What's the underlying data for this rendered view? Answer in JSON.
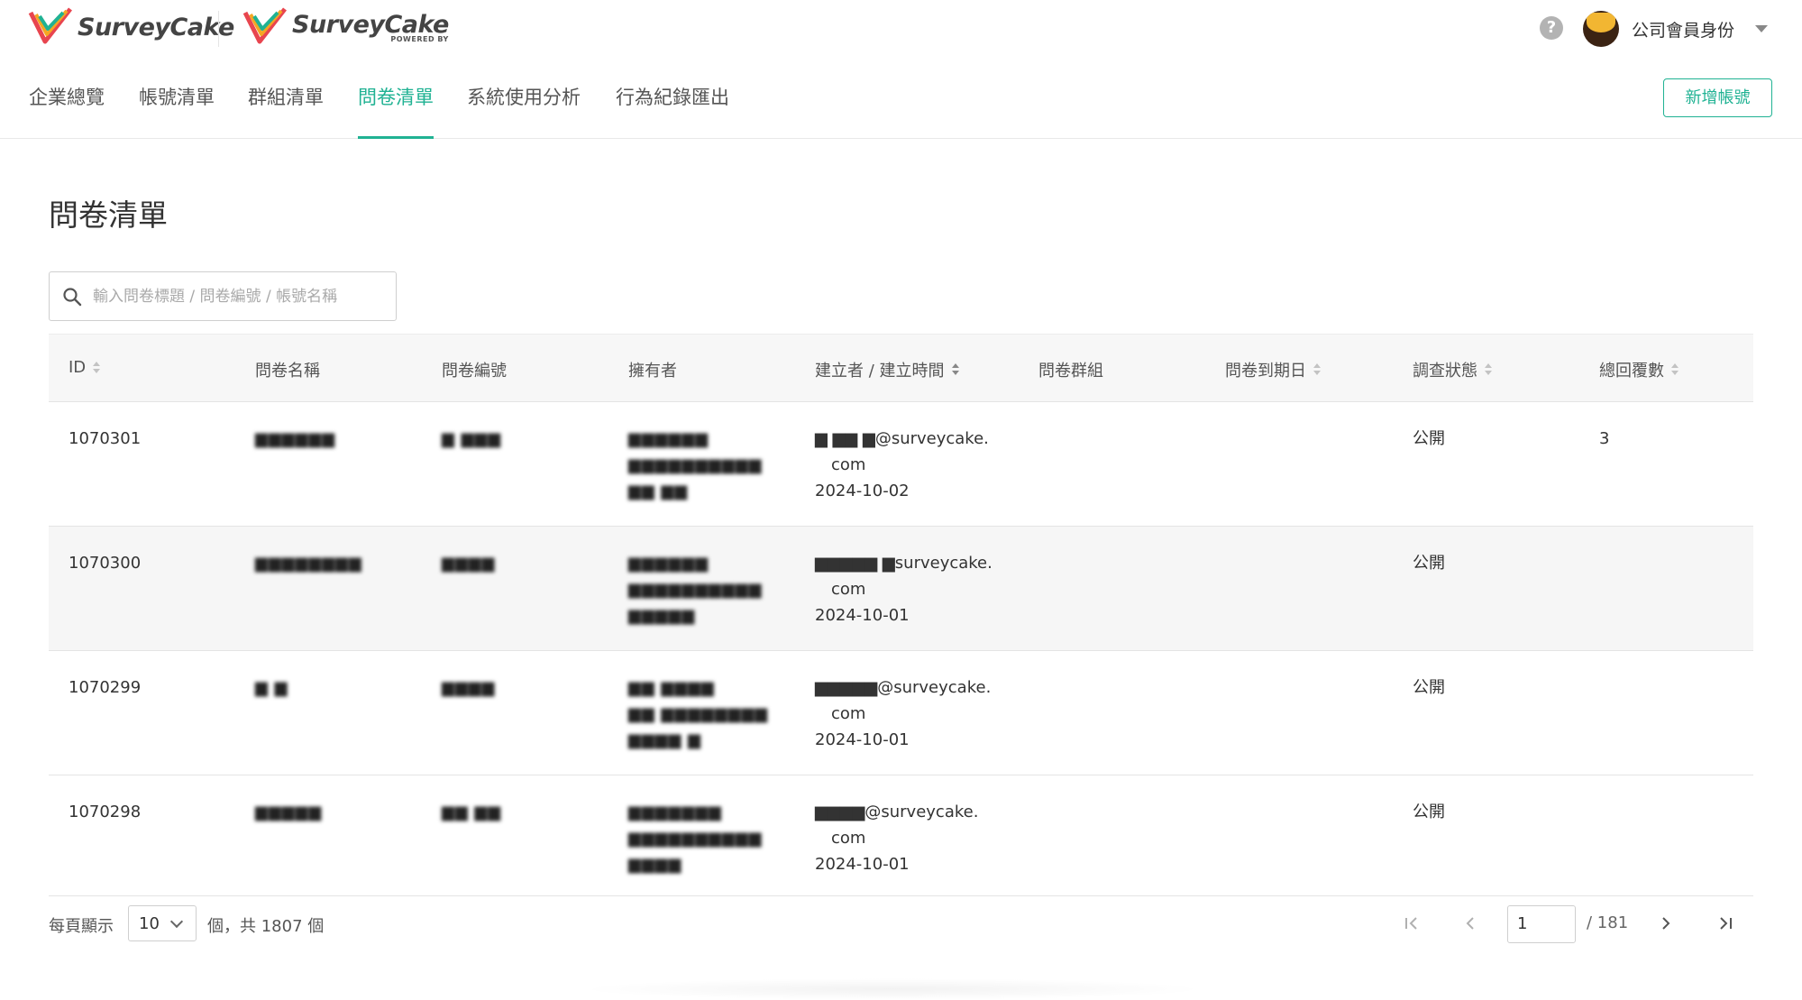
{
  "brand": {
    "logo_text": "SurveyCake",
    "logo2_text": "SurveyCake",
    "powered_by": "POWERED BY",
    "accent_color": "#20b293"
  },
  "header": {
    "help_icon": "question-circle-icon",
    "user_label": "公司會員身份"
  },
  "nav": {
    "tabs": [
      {
        "label": "企業總覽",
        "active": false
      },
      {
        "label": "帳號清單",
        "active": false
      },
      {
        "label": "群組清單",
        "active": false
      },
      {
        "label": "問卷清單",
        "active": true
      },
      {
        "label": "系統使用分析",
        "active": false
      },
      {
        "label": "行為紀錄匯出",
        "active": false
      }
    ],
    "add_account_label": "新增帳號"
  },
  "page": {
    "title": "問卷清單"
  },
  "search": {
    "placeholder": "輸入問卷標題 / 問卷編號 / 帳號名稱",
    "value": ""
  },
  "table": {
    "columns": [
      "ID",
      "問卷名稱",
      "問卷編號",
      "擁有者",
      "建立者 / 建立時間",
      "問卷群組",
      "問卷到期日",
      "調查狀態",
      "總回覆數"
    ],
    "rows": [
      {
        "id": "1070301",
        "name": "▆▆▆▆▆▆",
        "code": "▆ ▆▆▆",
        "owner": [
          "▆▆▆▆▆▆",
          "▆▆▆▆▆▆▆▆▆▆",
          "▆▆ ▆▆"
        ],
        "creator_email_1": "▆ ▆▆ ▆@surveycake.",
        "creator_email_2": "com",
        "created": "2024-10-02",
        "group": "",
        "expiry": "",
        "status": "公開",
        "replies": "3"
      },
      {
        "id": "1070300",
        "name": "▆▆▆▆▆▆▆▆",
        "code": "▆▆▆▆",
        "owner": [
          "▆▆▆▆▆▆",
          "▆▆▆▆▆▆▆▆▆▆",
          "▆▆▆▆▆"
        ],
        "creator_email_1": "▆▆▆▆▆ ▆surveycake.",
        "creator_email_2": "com",
        "created": "2024-10-01",
        "group": "",
        "expiry": "",
        "status": "公開",
        "replies": ""
      },
      {
        "id": "1070299",
        "name": "▆ ▆",
        "code": "▆▆▆▆",
        "owner": [
          "▆▆ ▆▆▆▆",
          "▆▆ ▆▆▆▆▆▆▆▆",
          "▆▆▆▆ ▆"
        ],
        "creator_email_1": "▆▆▆▆▆@surveycake.",
        "creator_email_2": "com",
        "created": "2024-10-01",
        "group": "",
        "expiry": "",
        "status": "公開",
        "replies": ""
      },
      {
        "id": "1070298",
        "name": "▆▆▆▆▆",
        "code": "▆▆ ▆▆",
        "owner": [
          "▆▆▆▆▆▆▆",
          "▆▆▆▆▆▆▆▆▆▆",
          "▆▆▆▆"
        ],
        "creator_email_1": "▆▆▆▆@surveycake.",
        "creator_email_2": "com",
        "created": "2024-10-01",
        "group": "",
        "expiry": "",
        "status": "公開",
        "replies": ""
      }
    ]
  },
  "pagination": {
    "per_page_label": "每頁顯示",
    "page_size": "10",
    "total_label": "個，共 1807 個",
    "current_page": "1",
    "total_pages": "/ 181",
    "first_icon": "first-page-icon",
    "prev_icon": "prev-page-icon",
    "next_icon": "next-page-icon",
    "last_icon": "last-page-icon"
  }
}
